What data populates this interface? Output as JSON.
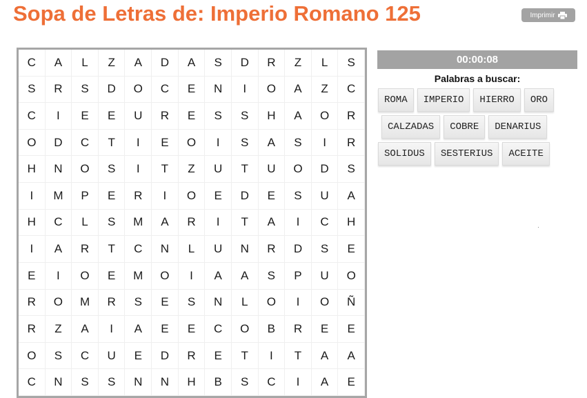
{
  "header": {
    "title": "Sopa de Letras de: Imperio Romano 125",
    "print_label": "Imprimir",
    "print_icon": "printer-icon"
  },
  "timer": "00:00:08",
  "words_title": "Palabras a buscar:",
  "words": [
    [
      "ROMA",
      "IMPERIO",
      "HIERRO",
      "ORO"
    ],
    [
      "CALZADAS",
      "COBRE",
      "DENARIUS"
    ],
    [
      "SOLIDUS",
      "SESTERIUS",
      "ACEITE"
    ]
  ],
  "grid": [
    [
      "C",
      "A",
      "L",
      "Z",
      "A",
      "D",
      "A",
      "S",
      "D",
      "R",
      "Z",
      "L",
      "S"
    ],
    [
      "S",
      "R",
      "S",
      "D",
      "O",
      "C",
      "E",
      "N",
      "I",
      "O",
      "A",
      "Z",
      "C"
    ],
    [
      "C",
      "I",
      "E",
      "E",
      "U",
      "R",
      "E",
      "S",
      "S",
      "H",
      "A",
      "O",
      "R"
    ],
    [
      "O",
      "D",
      "C",
      "T",
      "I",
      "E",
      "O",
      "I",
      "S",
      "A",
      "S",
      "I",
      "R"
    ],
    [
      "H",
      "N",
      "O",
      "S",
      "I",
      "T",
      "Z",
      "U",
      "T",
      "U",
      "O",
      "D",
      "S"
    ],
    [
      "I",
      "M",
      "P",
      "E",
      "R",
      "I",
      "O",
      "E",
      "D",
      "E",
      "S",
      "U",
      "A"
    ],
    [
      "H",
      "C",
      "L",
      "S",
      "M",
      "A",
      "R",
      "I",
      "T",
      "A",
      "I",
      "C",
      "H"
    ],
    [
      "I",
      "A",
      "R",
      "T",
      "C",
      "N",
      "L",
      "U",
      "N",
      "R",
      "D",
      "S",
      "E"
    ],
    [
      "E",
      "I",
      "O",
      "E",
      "M",
      "O",
      "I",
      "A",
      "A",
      "S",
      "P",
      "U",
      "O"
    ],
    [
      "R",
      "O",
      "M",
      "R",
      "S",
      "E",
      "S",
      "N",
      "L",
      "O",
      "I",
      "O",
      "Ñ"
    ],
    [
      "R",
      "Z",
      "A",
      "I",
      "A",
      "E",
      "E",
      "C",
      "O",
      "B",
      "R",
      "E",
      "E"
    ],
    [
      "O",
      "S",
      "C",
      "U",
      "E",
      "D",
      "R",
      "E",
      "T",
      "I",
      "T",
      "A",
      "A"
    ],
    [
      "C",
      "N",
      "S",
      "S",
      "N",
      "N",
      "H",
      "B",
      "S",
      "C",
      "I",
      "A",
      "E"
    ]
  ],
  "colors": {
    "title": "#ee6f37",
    "timer_bg": "#a3a3a3",
    "grid_border": "#a6a6a6"
  }
}
